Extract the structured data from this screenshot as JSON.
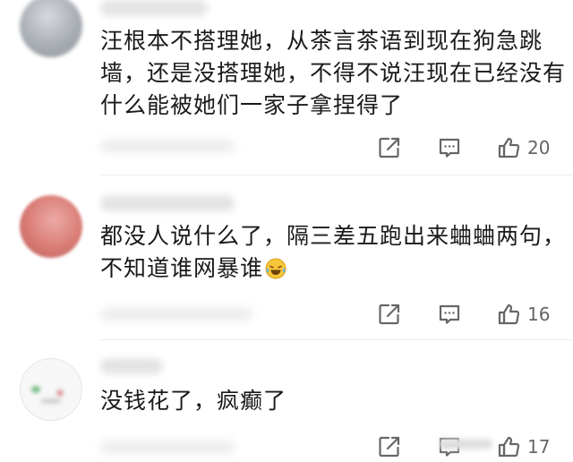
{
  "comments": [
    {
      "text": "汪根本不搭理她，从茶言茶语到现在狗急跳墙，还是没搭理她，不得不说汪现在已经没有什么能被她们一家子拿捏得了",
      "likes": "20"
    },
    {
      "text": "都没人说什么了，隔三差五跑出来蛐蛐两句，不知道谁网暴谁",
      "emoji": "crying-laughing-emoji",
      "likes": "16"
    },
    {
      "text": "没钱花了，疯癫了",
      "likes": "17"
    }
  ],
  "icons": {
    "share": "share-icon",
    "comment": "comment-icon",
    "like": "thumbs-up-icon"
  },
  "colors": {
    "text": "#1a1a1a",
    "icon": "#666666",
    "divider": "#ececec"
  }
}
